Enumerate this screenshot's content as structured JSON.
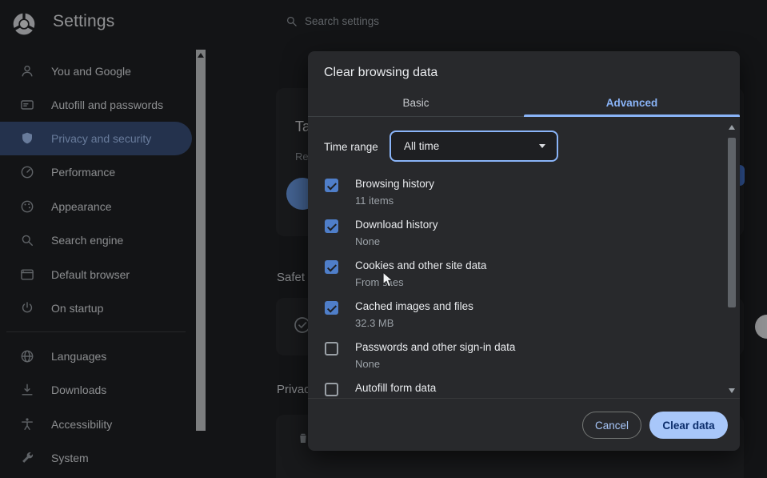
{
  "header": {
    "app_title": "Settings",
    "search_placeholder": "Search settings"
  },
  "sidebar": {
    "items": [
      {
        "label": "You and Google"
      },
      {
        "label": "Autofill and passwords"
      },
      {
        "label": "Privacy and security",
        "selected": true
      },
      {
        "label": "Performance"
      },
      {
        "label": "Appearance"
      },
      {
        "label": "Search engine"
      },
      {
        "label": "Default browser"
      },
      {
        "label": "On startup"
      },
      {
        "label": "Languages"
      },
      {
        "label": "Downloads"
      },
      {
        "label": "Accessibility"
      },
      {
        "label": "System"
      }
    ]
  },
  "page": {
    "card_title_fragment": "Ta",
    "card_sub_fragment": "Re",
    "section_safety_fragment": "Safet",
    "section_privacy_fragment": "Privac"
  },
  "dialog": {
    "title": "Clear browsing data",
    "tabs": {
      "basic": "Basic",
      "advanced": "Advanced"
    },
    "time_range_label": "Time range",
    "time_range_value": "All time",
    "rows": [
      {
        "label": "Browsing history",
        "detail": "11 items",
        "checked": true
      },
      {
        "label": "Download history",
        "detail": "None",
        "checked": true
      },
      {
        "label": "Cookies and other site data",
        "detail": "From sites",
        "checked": true
      },
      {
        "label": "Cached images and files",
        "detail": "32.3 MB",
        "checked": true
      },
      {
        "label": "Passwords and other sign-in data",
        "detail": "None",
        "checked": false
      },
      {
        "label": "Autofill form data",
        "detail": "",
        "checked": false
      }
    ],
    "cancel_label": "Cancel",
    "confirm_label": "Clear data"
  },
  "colors": {
    "accent": "#8ab4f8",
    "checkbox_checked": "#4f7ec9",
    "confirm_button_bg": "#a8c7fa",
    "dialog_bg": "#28292c",
    "page_bg": "#202124"
  }
}
